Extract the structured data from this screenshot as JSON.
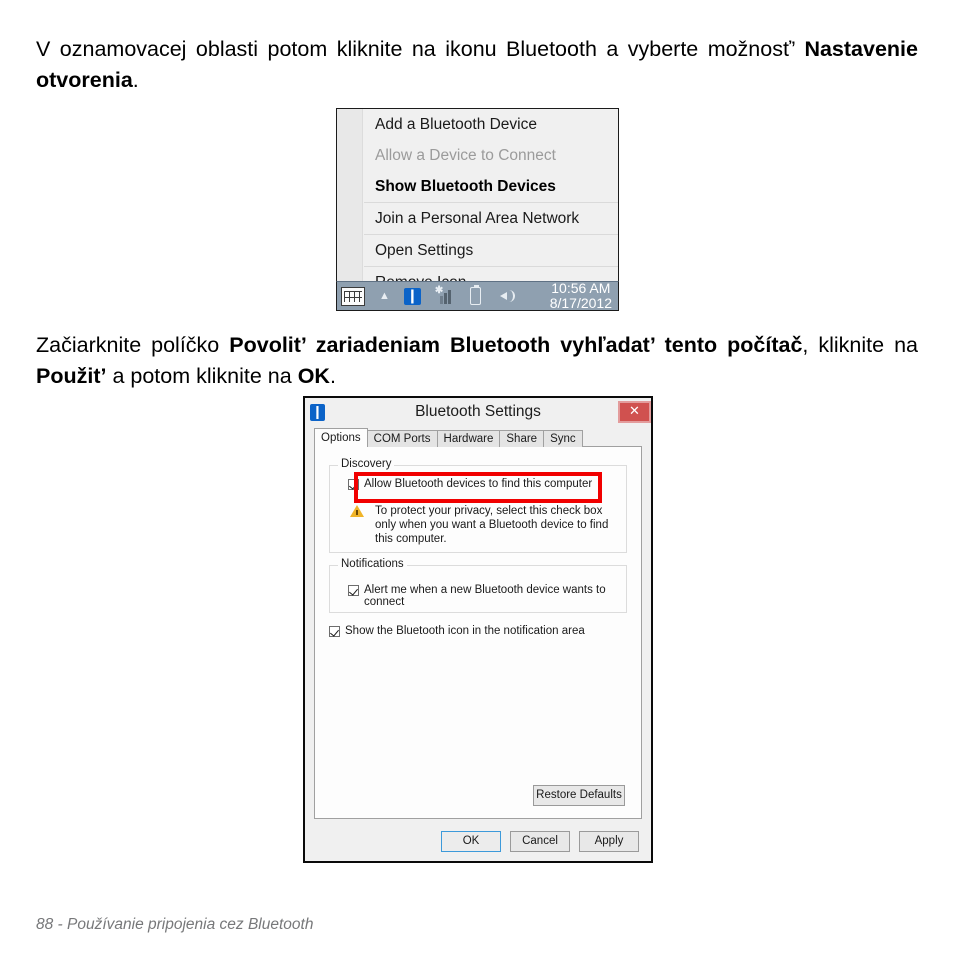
{
  "page": {
    "paragraph1_part1": "V oznamovacej oblasti potom kliknite na ikonu Bluetooth a vyberte možnosť’ ",
    "paragraph1_bold": "Nastavenie otvorenia",
    "paragraph1_part2": ".",
    "paragraph2_part1": "Začiarknite políčko ",
    "paragraph2_bold1": "Povolit’ zariadeniam Bluetooth vyhľadat’ tento počítač",
    "paragraph2_part2": ", kliknite na ",
    "paragraph2_bold2": "Použit’",
    "paragraph2_part3": " a potom kliknite na ",
    "paragraph2_bold3": "OK",
    "paragraph2_part4": ".",
    "footer": "88 - Používanie pripojenia cez Bluetooth"
  },
  "tray_menu": {
    "items": [
      {
        "label": "Add a Bluetooth Device",
        "state": "normal"
      },
      {
        "label": "Allow a Device to Connect",
        "state": "disabled"
      },
      {
        "label": "Show Bluetooth Devices",
        "state": "bold"
      },
      {
        "label": "Join a Personal Area Network",
        "state": "normal"
      },
      {
        "label": "Open Settings",
        "state": "normal"
      },
      {
        "label": "Remove Icon",
        "state": "normal"
      }
    ]
  },
  "taskbar": {
    "keyboard_icon": "keyboard-icon",
    "overflow_icon": "chevron-up-icon",
    "bluetooth_icon": "bluetooth-icon",
    "network_icon": "network-signal-icon",
    "battery_icon": "battery-icon",
    "volume_icon": "speaker-icon",
    "time": "10:56 AM",
    "date": "8/17/2012",
    "background_color": "#8fa0b0"
  },
  "dialog": {
    "title": "Bluetooth Settings",
    "title_icon": "bluetooth-icon",
    "close_label": "✕",
    "close_color": "#d0514f",
    "tabs": [
      {
        "label": "Options",
        "active": true
      },
      {
        "label": "COM Ports",
        "active": false
      },
      {
        "label": "Hardware",
        "active": false
      },
      {
        "label": "Share",
        "active": false
      },
      {
        "label": "Sync",
        "active": false
      }
    ],
    "discovery": {
      "group_label": "Discovery",
      "checkbox_label": "Allow Bluetooth devices to find this computer",
      "checkbox_checked": true,
      "warning_icon": "warning-triangle-icon",
      "warning_text": "To protect your privacy, select this check box only when you want a Bluetooth device to find this computer."
    },
    "notifications": {
      "group_label": "Notifications",
      "checkbox_label": "Alert me when a new Bluetooth device wants to connect",
      "checkbox_checked": true
    },
    "show_icon": {
      "checkbox_label": "Show the Bluetooth icon in the notification area",
      "checkbox_checked": true
    },
    "restore_defaults_label": "Restore Defaults",
    "buttons": [
      {
        "label": "OK",
        "focused": true
      },
      {
        "label": "Cancel",
        "focused": false
      },
      {
        "label": "Apply",
        "focused": false
      }
    ],
    "highlight_color": "#f10000"
  }
}
